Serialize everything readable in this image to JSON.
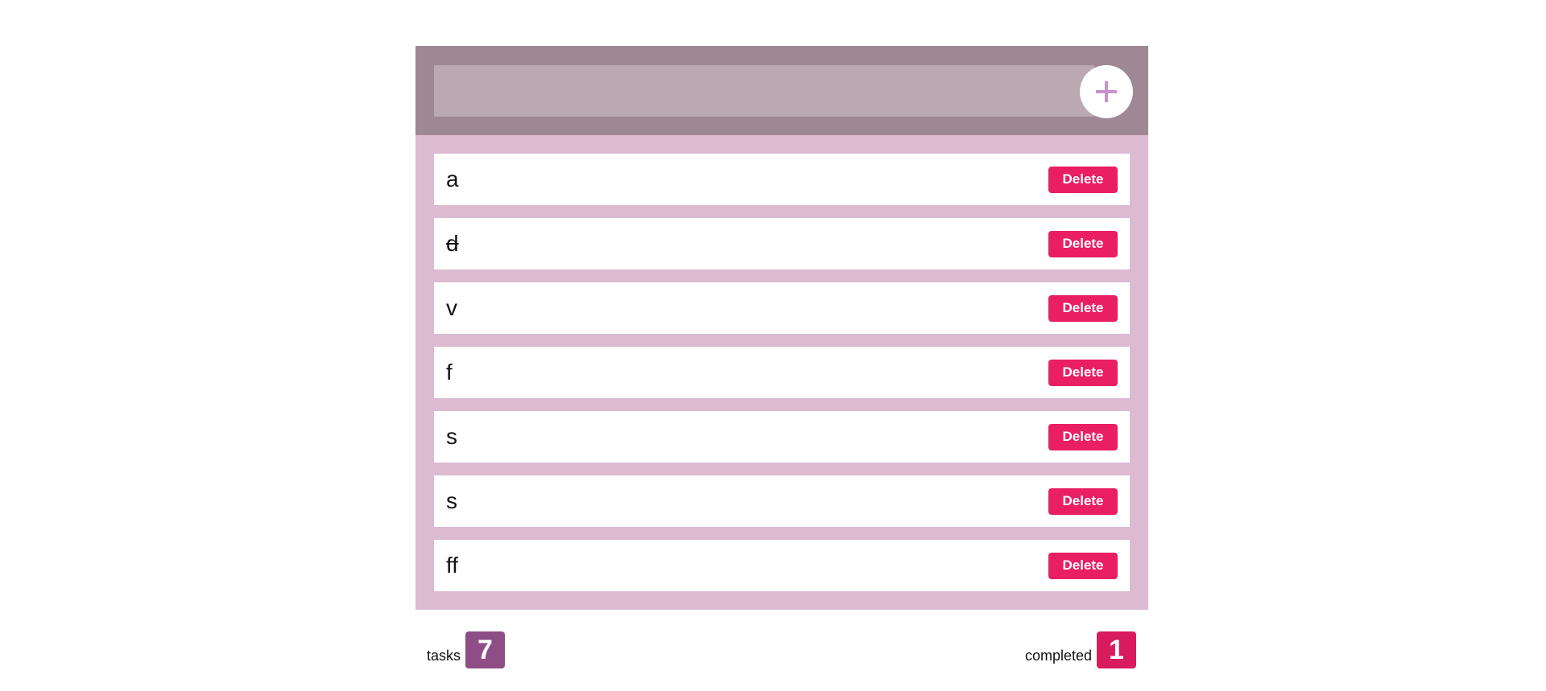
{
  "header": {
    "input_value": "",
    "input_placeholder": "",
    "add_icon": "plus-icon"
  },
  "tasks": [
    {
      "label": "a",
      "completed": false,
      "delete_label": "Delete"
    },
    {
      "label": "d",
      "completed": true,
      "delete_label": "Delete"
    },
    {
      "label": "v",
      "completed": false,
      "delete_label": "Delete"
    },
    {
      "label": "f",
      "completed": false,
      "delete_label": "Delete"
    },
    {
      "label": "s",
      "completed": false,
      "delete_label": "Delete"
    },
    {
      "label": "s",
      "completed": false,
      "delete_label": "Delete"
    },
    {
      "label": "ff",
      "completed": false,
      "delete_label": "Delete"
    }
  ],
  "footer": {
    "tasks_label": "tasks",
    "tasks_count": "7",
    "completed_label": "completed",
    "completed_count": "1"
  },
  "colors": {
    "header_bg": "#9e8893",
    "input_bg": "#baa9b1",
    "list_bg": "#dbbad2",
    "accent_plus": "#c992cf",
    "delete_button": "#e91e63",
    "tasks_badge": "#8e4d85",
    "completed_badge": "#d81b5d"
  }
}
